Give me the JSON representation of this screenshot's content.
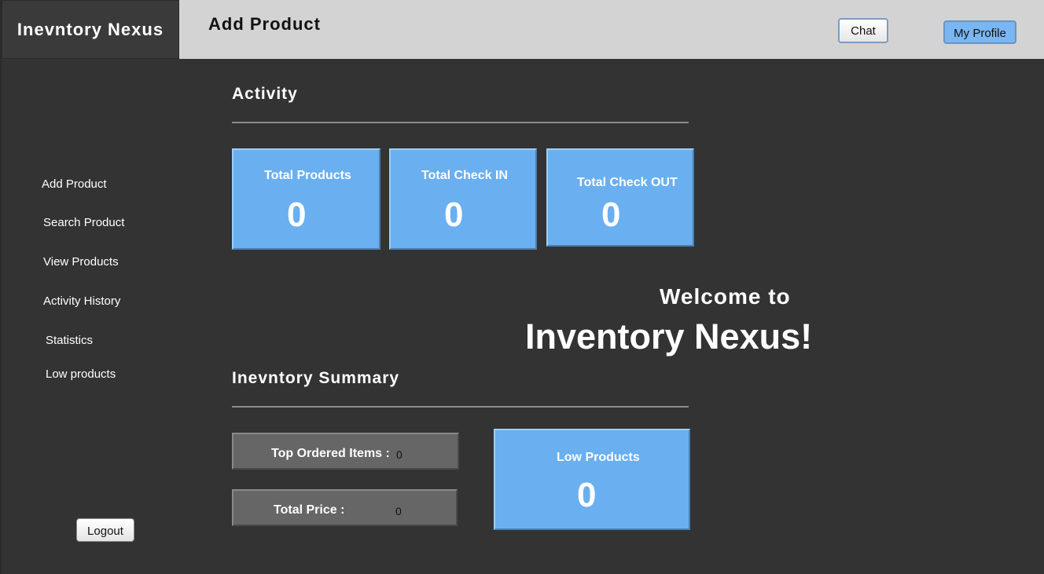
{
  "app": {
    "brand": "Inevntory Nexus",
    "page_title": "Add Product"
  },
  "header": {
    "chat_label": "Chat",
    "profile_label": "My Profile"
  },
  "sidebar": {
    "items": [
      {
        "label": "Add Product"
      },
      {
        "label": "Search Product"
      },
      {
        "label": "View Products"
      },
      {
        "label": "Activity History"
      },
      {
        "label": "Statistics"
      },
      {
        "label": "Low products"
      }
    ],
    "logout_label": "Logout"
  },
  "activity": {
    "title": "Activity",
    "cards": [
      {
        "label": "Total Products",
        "value": "0"
      },
      {
        "label": "Total Check IN",
        "value": "0"
      },
      {
        "label": "Total Check OUT",
        "value": "0"
      }
    ]
  },
  "welcome": {
    "line1": "Welcome to",
    "line2": "Inventory Nexus!"
  },
  "summary": {
    "title": "Inevntory Summary",
    "top_ordered_label": "Top Ordered Items :",
    "top_ordered_value": "0",
    "total_price_label": "Total Price :",
    "total_price_value": "0",
    "low_products_label": "Low Products",
    "low_products_value": "0"
  },
  "colors": {
    "background": "#333333",
    "card_blue": "#6aaff0",
    "topbar": "#d3d3d3",
    "summary_gray": "#666666"
  }
}
